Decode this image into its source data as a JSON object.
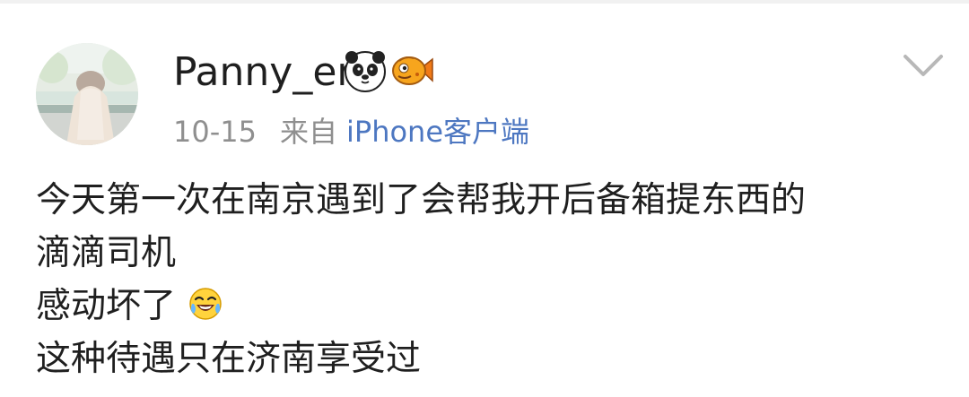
{
  "post": {
    "author": {
      "username": "Panny_er",
      "badges": [
        "panda-badge-icon",
        "fish-badge-icon"
      ]
    },
    "meta": {
      "time": "10-15",
      "from_label": "来自",
      "source": "iPhone客户端"
    },
    "content": {
      "line_1": "今天第一次在南京遇到了会帮我开后备箱提东西的",
      "line_2": "滴滴司机",
      "line_3": "感动坏了",
      "line_3_emoji": "laughing-tears-emoji",
      "line_4": "这种待遇只在济南享受过"
    },
    "colors": {
      "text": "#1f1f1f",
      "meta": "#8f8f8f",
      "link": "#4d77c1",
      "background": "#ffffff"
    }
  }
}
